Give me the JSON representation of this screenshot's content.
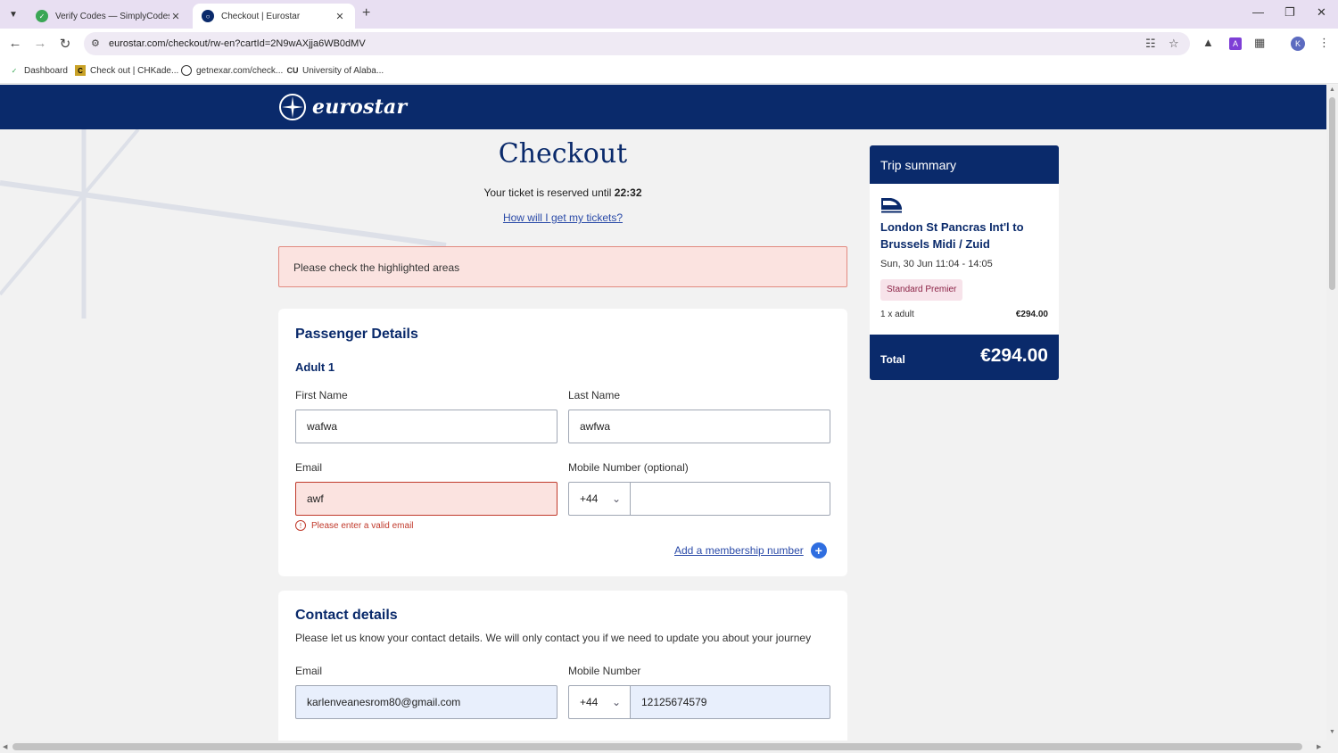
{
  "browser": {
    "tabs": [
      {
        "title": "Verify Codes — SimplyCodes",
        "active": false
      },
      {
        "title": "Checkout | Eurostar",
        "active": true
      }
    ],
    "url": "eurostar.com/checkout/rw-en?cartId=2N9wAXjja6WB0dMV",
    "profile_initial": "K",
    "bookmarks": [
      {
        "label": "Dashboard"
      },
      {
        "label": "Check out | CHKade..."
      },
      {
        "label": "getnexar.com/check..."
      },
      {
        "label": "University of Alaba..."
      }
    ]
  },
  "header": {
    "brand": "eurostar"
  },
  "checkout": {
    "title": "Checkout",
    "reserved_prefix": "Your ticket is reserved until",
    "reserved_time": "22:32",
    "tickets_link": "How will I get my tickets?",
    "error_banner": "Please check the highlighted areas"
  },
  "passenger": {
    "title": "Passenger Details",
    "subtitle": "Adult 1",
    "first_name_label": "First Name",
    "first_name_value": "wafwa",
    "last_name_label": "Last Name",
    "last_name_value": "awfwa",
    "email_label": "Email",
    "email_value": "awf",
    "email_error": "Please enter a valid email",
    "mobile_label": "Mobile Number (optional)",
    "country_code": "+44",
    "mobile_value": "",
    "membership_link": "Add a membership number"
  },
  "contact": {
    "title": "Contact details",
    "description": "Please let us know your contact details. We will only contact you if we need to update you about your journey",
    "email_label": "Email",
    "email_value": "karlenveanesrom80@gmail.com",
    "mobile_label": "Mobile Number",
    "country_code": "+44",
    "mobile_value": "12125674579"
  },
  "summary": {
    "title": "Trip summary",
    "route": "London St Pancras Int'l to Brussels Midi / Zuid",
    "datetime": "Sun, 30 Jun 11:04 - 14:05",
    "fare_class": "Standard Premier",
    "passengers": "1 x adult",
    "passengers_price": "€294.00",
    "total_label": "Total",
    "total_price": "€294.00"
  },
  "colors": {
    "brand_navy": "#0a2a6b",
    "error_bg": "#fbe3e0",
    "error_text": "#c0392b",
    "link_blue": "#2a4aa8"
  }
}
